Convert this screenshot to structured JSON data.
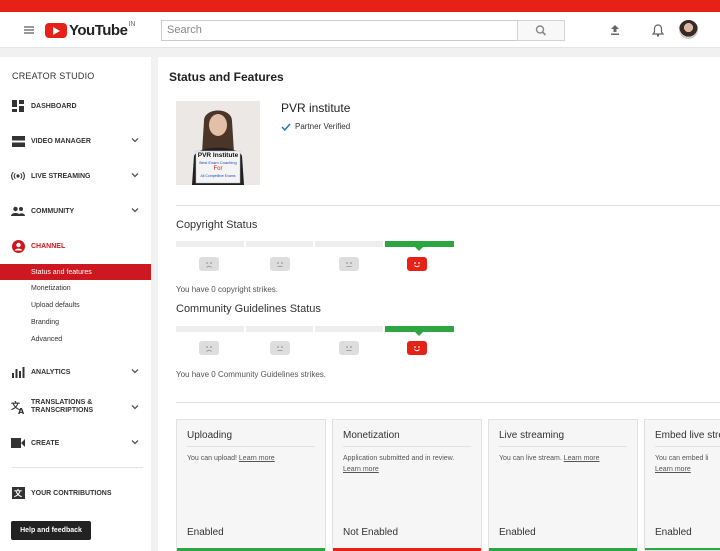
{
  "header": {
    "logo_text": "YouTube",
    "country_code": "IN",
    "search_placeholder": "Search"
  },
  "sidebar": {
    "title": "CREATOR STUDIO",
    "items": [
      {
        "label": "DASHBOARD",
        "icon": "dashboard-icon"
      },
      {
        "label": "VIDEO MANAGER",
        "icon": "video-manager-icon"
      },
      {
        "label": "LIVE STREAMING",
        "icon": "live-streaming-icon"
      },
      {
        "label": "COMMUNITY",
        "icon": "community-icon"
      },
      {
        "label": "CHANNEL",
        "icon": "channel-icon"
      },
      {
        "label": "ANALYTICS",
        "icon": "analytics-icon"
      },
      {
        "label": "TRANSLATIONS & TRANSCRIPTIONS",
        "icon": "translate-icon"
      },
      {
        "label": "CREATE",
        "icon": "create-icon"
      },
      {
        "label": "YOUR CONTRIBUTIONS",
        "icon": "contributions-icon"
      }
    ],
    "channel_sub": [
      "Status and features",
      "Monetization",
      "Upload defaults",
      "Branding",
      "Advanced"
    ],
    "help_label": "Help and feedback"
  },
  "main": {
    "page_title": "Status and Features",
    "channel_name": "PVR institute",
    "verified_text": "Partner Verified",
    "thumb_lines": [
      "PVR Institute",
      "Best Exam Coaching",
      "For",
      "All Competitive Exams"
    ],
    "copyright": {
      "title": "Copyright Status",
      "text": "You have 0 copyright strikes."
    },
    "guidelines": {
      "title": "Community Guidelines Status",
      "text": "You have 0 Community Guidelines strikes."
    },
    "cards": [
      {
        "title": "Uploading",
        "text": "You can upload! ",
        "link": "Learn more",
        "status": "Enabled",
        "status_color": "#2ba640"
      },
      {
        "title": "Monetization",
        "text": "Application submitted and in review. ",
        "link": "Learn more",
        "status": "Not Enabled",
        "status_color": "#e62117"
      },
      {
        "title": "Live streaming",
        "text": "You can live stream. ",
        "link": "Learn more",
        "status": "Enabled",
        "status_color": "#2ba640"
      },
      {
        "title": "Embed live stre",
        "text": "You can embed li",
        "link": "Learn more",
        "status": "Enabled",
        "status_color": "#2ba640"
      }
    ]
  },
  "colors": {
    "brand_red": "#e62117",
    "active_red": "#cc181e",
    "good_green": "#2ba640"
  }
}
